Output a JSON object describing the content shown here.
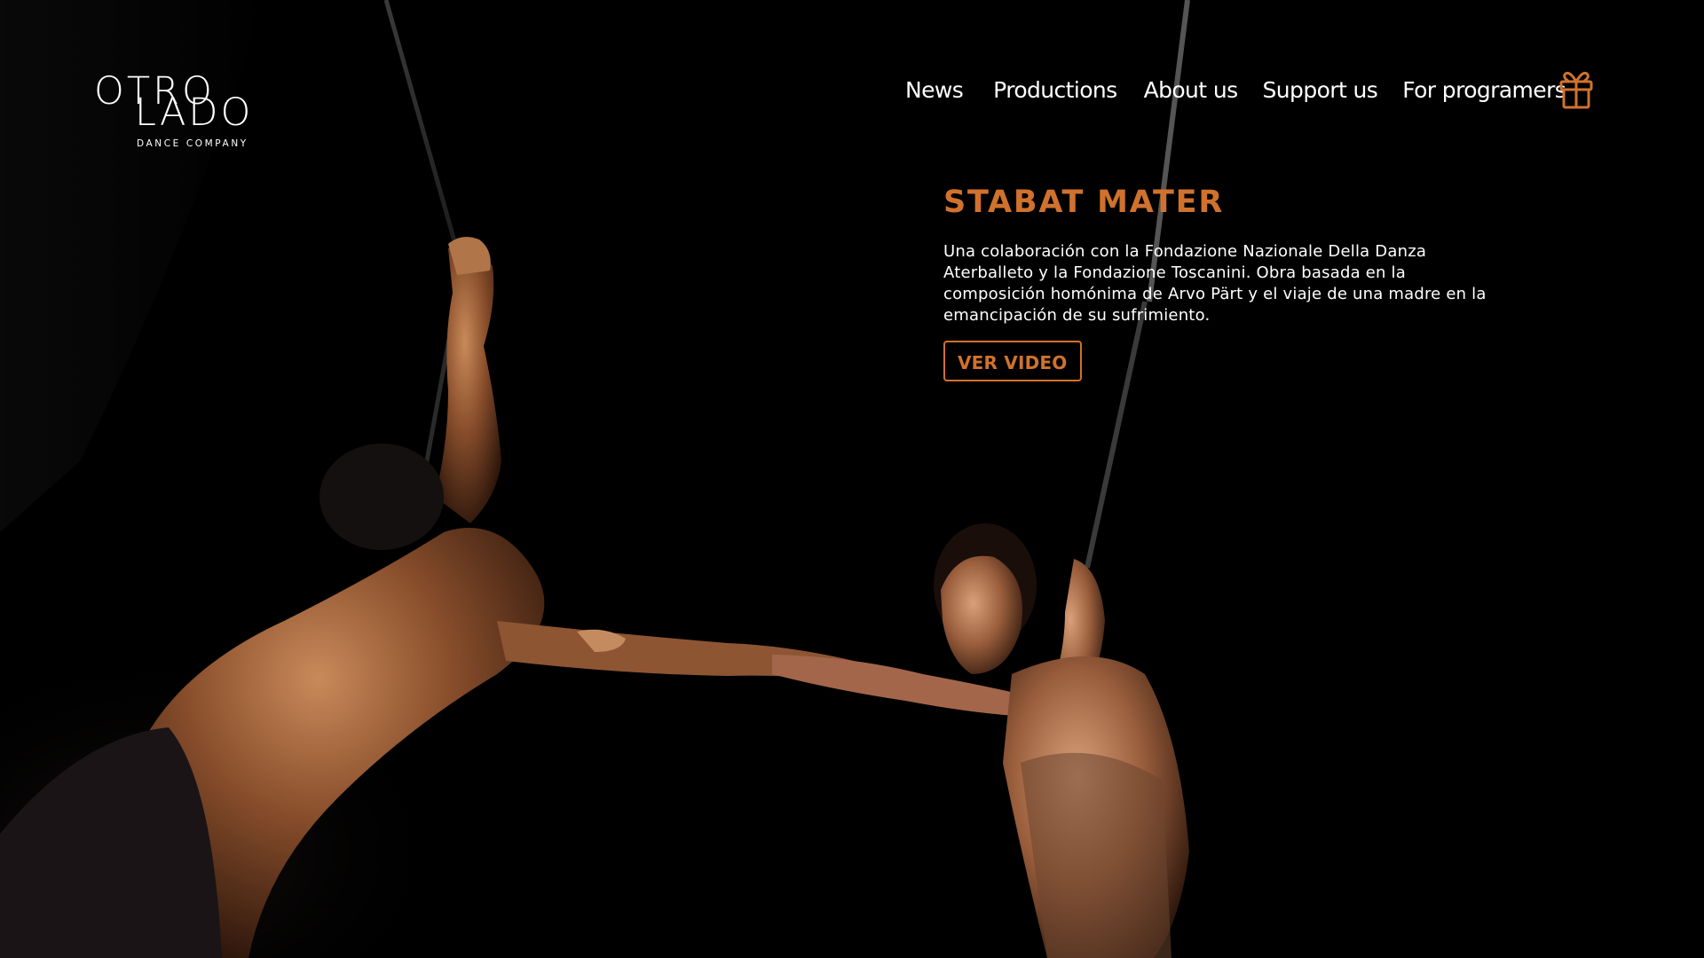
{
  "brand": {
    "logo_line1": "OTRO",
    "logo_line2": "LADO",
    "logo_tagline": "DANCE COMPANY"
  },
  "nav": {
    "items": [
      {
        "label": "News"
      },
      {
        "label": "Productions"
      },
      {
        "label": "About us"
      },
      {
        "label": "Support us"
      },
      {
        "label": "For programers"
      }
    ],
    "gift_icon": "gift-icon"
  },
  "hero": {
    "title": "STABAT MATER",
    "description": "Una colaboración con la Fondazione Nazionale Della Danza Aterballeto y la Fondazione Toscanini. Obra basada en la composición homónima de Arvo Pärt y el viaje de una madre en la emancipación de su sufrimiento.",
    "button_label": "VER VIDEO",
    "image_description": "dancers-on-ropes-photo"
  },
  "colors": {
    "accent": "#d0722d",
    "background": "#000000",
    "text": "#ffffff"
  }
}
